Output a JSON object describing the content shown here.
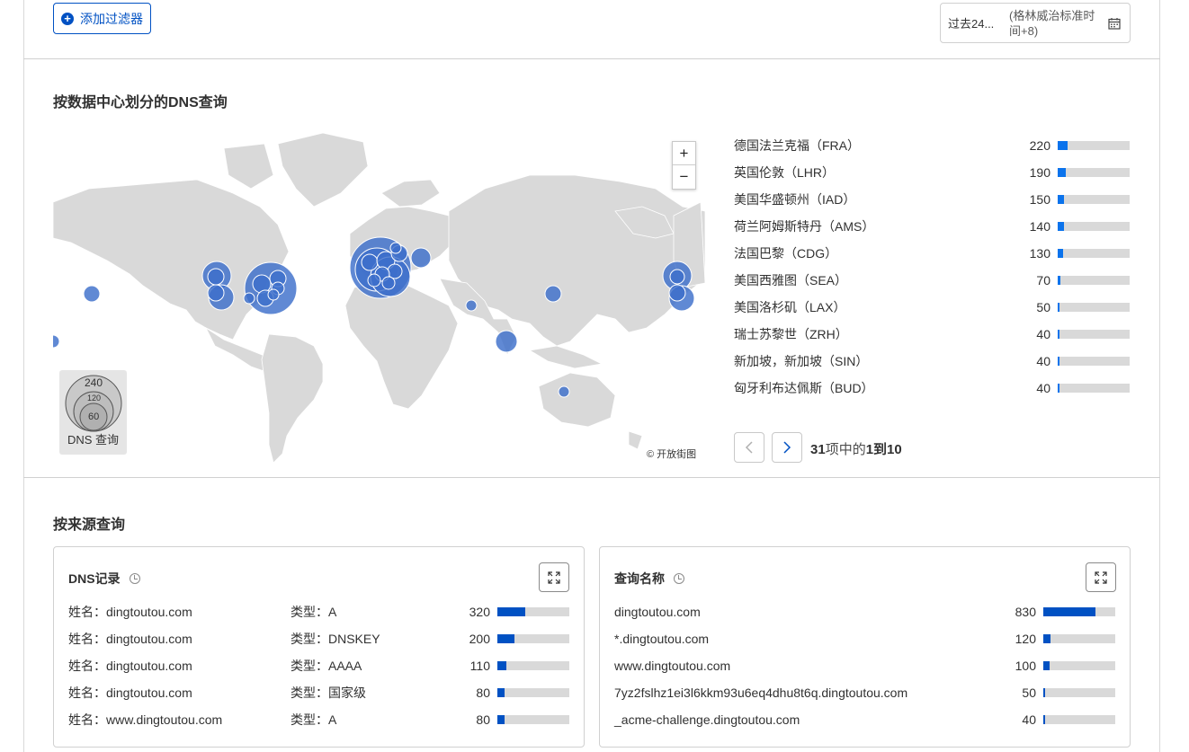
{
  "toolbar": {
    "add_filter_label": "添加过滤器",
    "time_range": "过去24...",
    "timezone": "(格林威治标准时间+8)"
  },
  "dc_section": {
    "title": "按数据中心划分的DNS查询",
    "legend_values": [
      "240",
      "120",
      "60"
    ],
    "legend_label": "DNS 查询",
    "attribution": "© 开放街图",
    "zoom_in": "+",
    "zoom_out": "−",
    "rows": [
      {
        "name": "德国法兰克福（FRA）",
        "value": "220",
        "fraction": 0.133
      },
      {
        "name": "英国伦敦（LHR）",
        "value": "190",
        "fraction": 0.115
      },
      {
        "name": "美国华盛顿州（IAD）",
        "value": "150",
        "fraction": 0.09
      },
      {
        "name": "荷兰阿姆斯特丹（AMS）",
        "value": "140",
        "fraction": 0.085
      },
      {
        "name": "法国巴黎（CDG）",
        "value": "130",
        "fraction": 0.078
      },
      {
        "name": "美国西雅图（SEA）",
        "value": "70",
        "fraction": 0.042
      },
      {
        "name": "美国洛杉矶（LAX）",
        "value": "50",
        "fraction": 0.03
      },
      {
        "name": "瑞士苏黎世（ZRH）",
        "value": "40",
        "fraction": 0.024
      },
      {
        "name": "新加坡，新加坡（SIN）",
        "value": "40",
        "fraction": 0.024
      },
      {
        "name": "匈牙利布达佩斯（BUD）",
        "value": "40",
        "fraction": 0.024
      }
    ],
    "pagination": {
      "total": "31",
      "mid": "项中的",
      "range": "1到10"
    },
    "bar_color": "#0b73ec"
  },
  "source_section": {
    "title": "按来源查询",
    "dns_records": {
      "title": "DNS记录",
      "rows": [
        {
          "name": "姓名：dingtoutou.com",
          "type": "类型：A",
          "value": "320",
          "fraction": 0.39
        },
        {
          "name": "姓名：dingtoutou.com",
          "type": "类型：DNSKEY",
          "value": "200",
          "fraction": 0.24
        },
        {
          "name": "姓名：dingtoutou.com",
          "type": "类型：AAAA",
          "value": "110",
          "fraction": 0.13
        },
        {
          "name": "姓名：dingtoutou.com",
          "type": "类型：国家级",
          "value": "80",
          "fraction": 0.1
        },
        {
          "name": "姓名：www.dingtoutou.com",
          "type": "类型：A",
          "value": "80",
          "fraction": 0.1
        }
      ]
    },
    "query_names": {
      "title": "查询名称",
      "rows": [
        {
          "name": "dingtoutou.com",
          "value": "830",
          "fraction": 0.72
        },
        {
          "name": "*.dingtoutou.com",
          "value": "120",
          "fraction": 0.1
        },
        {
          "name": "www.dingtoutou.com",
          "value": "100",
          "fraction": 0.09
        },
        {
          "name": "7yz2fslhz1ei3l6kkm93u6eq4dhu8t6q.dingtoutou.com",
          "value": "50",
          "fraction": 0.03
        },
        {
          "name": "_acme-challenge.dingtoutou.com",
          "value": "40",
          "fraction": 0.03
        }
      ]
    },
    "bar_color": "#0051c3"
  }
}
